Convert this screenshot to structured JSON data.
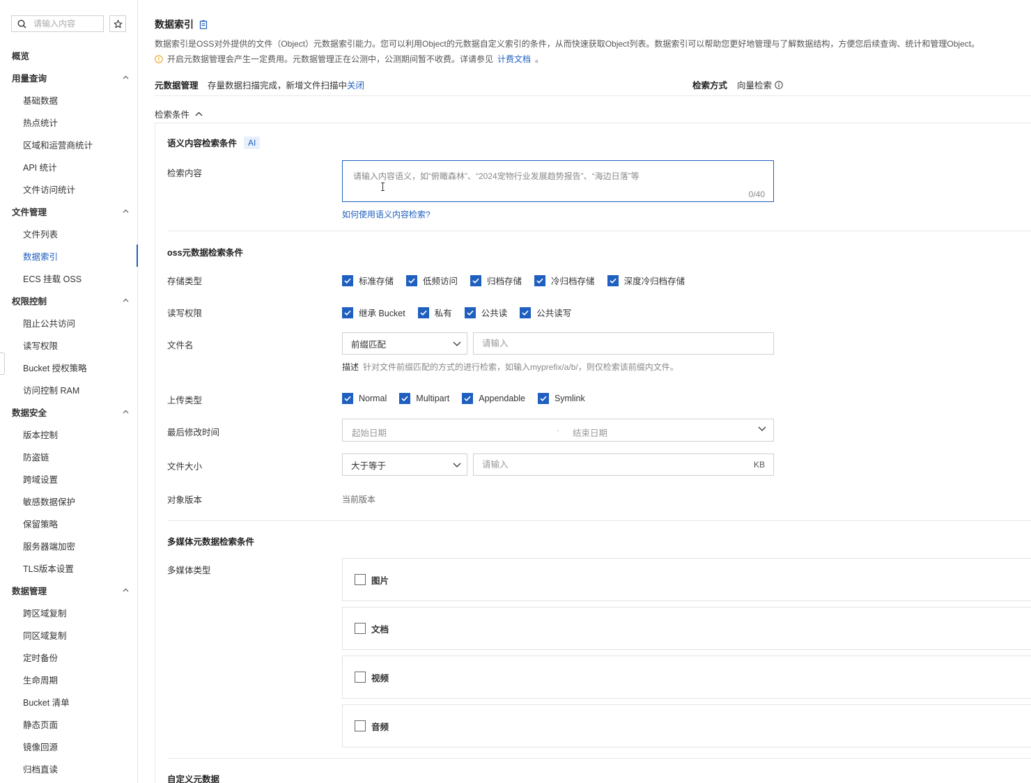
{
  "sidebar": {
    "search_placeholder": "请输入内容",
    "items": [
      {
        "label": "概览",
        "kind": "top"
      },
      {
        "label": "用量查询",
        "kind": "group"
      },
      {
        "label": "基础数据",
        "kind": "child"
      },
      {
        "label": "热点统计",
        "kind": "child"
      },
      {
        "label": "区域和运营商统计",
        "kind": "child"
      },
      {
        "label": "API 统计",
        "kind": "child"
      },
      {
        "label": "文件访问统计",
        "kind": "child"
      },
      {
        "label": "文件管理",
        "kind": "group"
      },
      {
        "label": "文件列表",
        "kind": "child"
      },
      {
        "label": "数据索引",
        "kind": "child",
        "active": true
      },
      {
        "label": "ECS 挂载 OSS",
        "kind": "child"
      },
      {
        "label": "权限控制",
        "kind": "group"
      },
      {
        "label": "阻止公共访问",
        "kind": "child"
      },
      {
        "label": "读写权限",
        "kind": "child"
      },
      {
        "label": "Bucket 授权策略",
        "kind": "child"
      },
      {
        "label": "访问控制 RAM",
        "kind": "child"
      },
      {
        "label": "数据安全",
        "kind": "group"
      },
      {
        "label": "版本控制",
        "kind": "child"
      },
      {
        "label": "防盗链",
        "kind": "child"
      },
      {
        "label": "跨域设置",
        "kind": "child"
      },
      {
        "label": "敏感数据保护",
        "kind": "child"
      },
      {
        "label": "保留策略",
        "kind": "child"
      },
      {
        "label": "服务器端加密",
        "kind": "child"
      },
      {
        "label": "TLS版本设置",
        "kind": "child"
      },
      {
        "label": "数据管理",
        "kind": "group"
      },
      {
        "label": "跨区域复制",
        "kind": "child"
      },
      {
        "label": "同区域复制",
        "kind": "child"
      },
      {
        "label": "定时备份",
        "kind": "child"
      },
      {
        "label": "生命周期",
        "kind": "child"
      },
      {
        "label": "Bucket 清单",
        "kind": "child"
      },
      {
        "label": "静态页面",
        "kind": "child"
      },
      {
        "label": "镜像回源",
        "kind": "child"
      },
      {
        "label": "归档直读",
        "kind": "child"
      }
    ]
  },
  "header": {
    "title": "数据索引",
    "description": "数据索引是OSS对外提供的文件（Object）元数据索引能力。您可以利用Object的元数据自定义索引的条件，从而快速获取Object列表。数据索引可以帮助您更好地管理与了解数据结构，方便您后续查询、统计和管理Object。",
    "notice": "开启元数据管理会产生一定费用。元数据管理正在公测中，公测期间暂不收费。详请参见",
    "notice_link": "计费文档",
    "notice_end": "。"
  },
  "meta": {
    "label": "元数据管理",
    "status": "存量数据扫描完成，新增文件扫描中",
    "close": "关闭",
    "mode_label": "检索方式",
    "mode_value": "向量检索"
  },
  "conditions_toggle": "检索条件",
  "semantic": {
    "title": "语义内容检索条件",
    "badge": "AI",
    "content_label": "检索内容",
    "placeholder": "请输入内容语义，如“俯瞰森林”、“2024宠物行业发展趋势报告”、“海边日落”等",
    "counter": "0/40",
    "help": "如何使用语义内容检索?"
  },
  "oss": {
    "title": "oss元数据检索条件",
    "storage_label": "存储类型",
    "storage_options": [
      "标准存储",
      "低频访问",
      "归档存储",
      "冷归档存储",
      "深度冷归档存储"
    ],
    "acl_label": "读写权限",
    "acl_options": [
      "继承 Bucket",
      "私有",
      "公共读",
      "公共读写"
    ],
    "filename_label": "文件名",
    "filename_match": "前缀匹配",
    "filename_placeholder": "请输入",
    "hint_label": "描述",
    "hint_text": "针对文件前缀匹配的方式的进行检索，如输入myprefix/a/b/，则仅检索该前缀内文件。",
    "upload_label": "上传类型",
    "upload_options": [
      "Normal",
      "Multipart",
      "Appendable",
      "Symlink"
    ],
    "modified_label": "最后修改时间",
    "start_date": "起始日期",
    "date_sep": "-",
    "end_date": "结束日期",
    "size_label": "文件大小",
    "size_op": "大于等于",
    "size_placeholder": "请输入",
    "size_unit": "KB",
    "version_label": "对象版本",
    "version_value": "当前版本"
  },
  "media": {
    "title": "多媒体元数据检索条件",
    "type_label": "多媒体类型",
    "types": [
      "图片",
      "文档",
      "视频",
      "音频"
    ]
  },
  "custom": {
    "title": "自定义元数据"
  },
  "colors": {
    "accent": "#1f5fbf",
    "warning": "#f0a020"
  }
}
